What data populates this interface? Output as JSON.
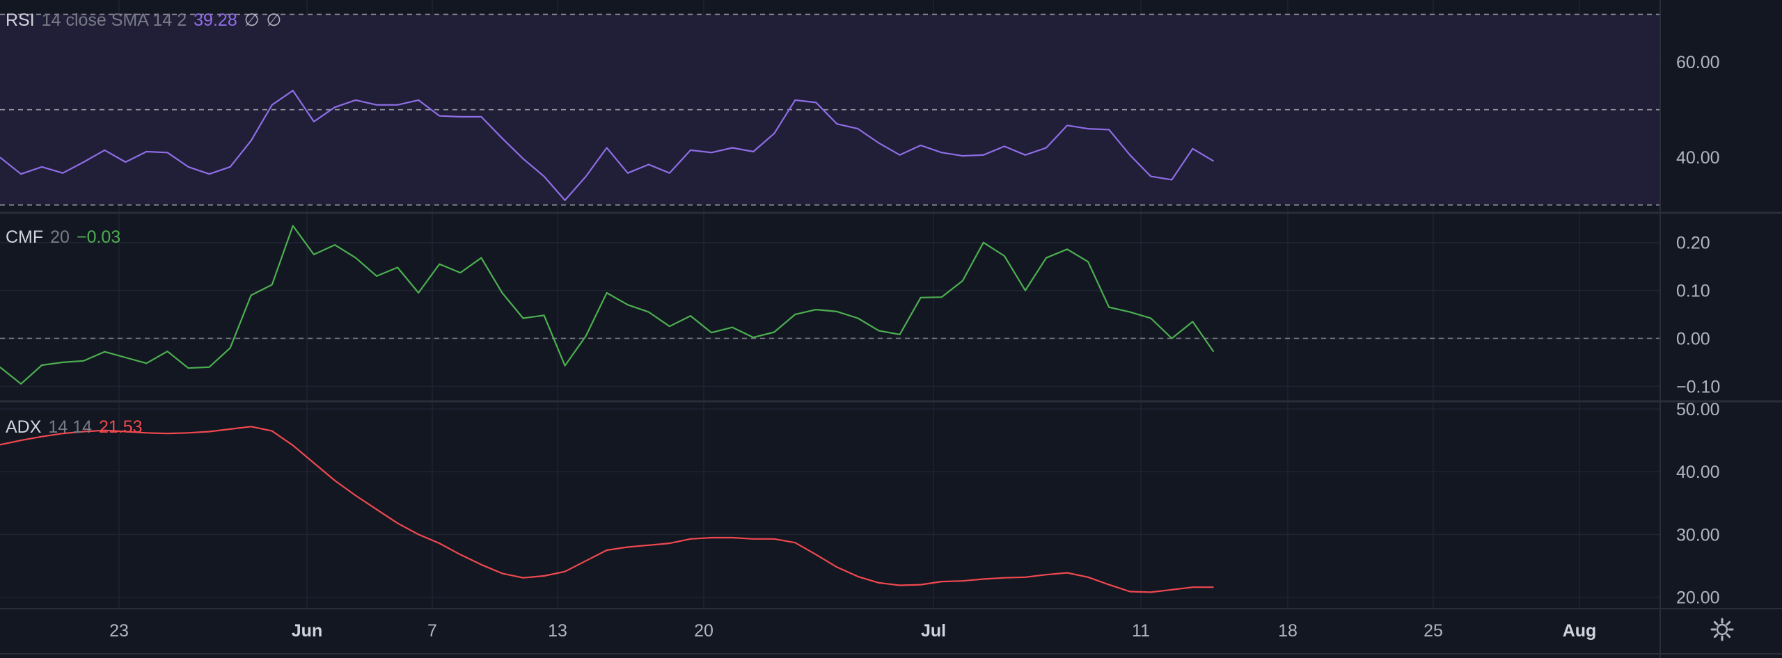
{
  "chart_data": {
    "type": "line",
    "x_axis": {
      "tick_labels": [
        "23",
        "Jun",
        "7",
        "13",
        "20",
        "Jul",
        "11",
        "18",
        "25",
        "Aug"
      ],
      "bold_ticks": [
        "Jun",
        "Jul",
        "Aug"
      ]
    },
    "panes": [
      {
        "id": "rsi",
        "legend": {
          "name": "RSI",
          "params": "14 close SMA 14 2",
          "value": "39.28",
          "extra": [
            "∅",
            "∅"
          ]
        },
        "color": "#8e6ee6",
        "band_fill": "#241f3a",
        "ylim": [
          28.5,
          73
        ],
        "band": [
          30,
          70
        ],
        "middle_line": 50,
        "y_ticks": [
          60,
          40
        ],
        "y_tick_labels": [
          "60.00",
          "40.00"
        ],
        "values": [
          40,
          36.5,
          38,
          36.7,
          39,
          41.5,
          39,
          41.2,
          41,
          38,
          36.5,
          38,
          43.5,
          51,
          54,
          47.5,
          50.5,
          52,
          51,
          51,
          52,
          48.7,
          48.5,
          48.5,
          44,
          39.7,
          36,
          31,
          36,
          42,
          36.7,
          38.5,
          36.7,
          41.5,
          41,
          42,
          41.2,
          45,
          52,
          51.5,
          47,
          46,
          43,
          40.5,
          42.5,
          41,
          40.3,
          40.5,
          42.3,
          40.5,
          42,
          46.7,
          46,
          45.8,
          40.5,
          36,
          35.3,
          41.8,
          39.2
        ]
      },
      {
        "id": "cmf",
        "legend": {
          "name": "CMF",
          "params": "20",
          "value": "−0.03"
        },
        "color": "#4caf50",
        "ylim": [
          -0.13,
          0.262
        ],
        "zero_line": 0,
        "y_ticks": [
          0.2,
          0.1,
          0,
          -0.1
        ],
        "y_tick_labels": [
          "0.20",
          "0.10",
          "0.00",
          "−0.10"
        ],
        "values": [
          -0.06,
          -0.095,
          -0.056,
          -0.05,
          -0.047,
          -0.028,
          -0.04,
          -0.052,
          -0.027,
          -0.062,
          -0.06,
          -0.02,
          0.09,
          0.112,
          0.235,
          0.175,
          0.195,
          0.168,
          0.13,
          0.148,
          0.095,
          0.155,
          0.137,
          0.168,
          0.095,
          0.042,
          0.048,
          -0.057,
          0.005,
          0.095,
          0.07,
          0.055,
          0.025,
          0.047,
          0.012,
          0.023,
          0.002,
          0.013,
          0.05,
          0.06,
          0.056,
          0.042,
          0.016,
          0.008,
          0.085,
          0.086,
          0.12,
          0.2,
          0.172,
          0.1,
          0.168,
          0.186,
          0.16,
          0.065,
          0.055,
          0.042,
          0,
          0.035,
          -0.028
        ]
      },
      {
        "id": "adx",
        "legend": {
          "name": "ADX",
          "params": "14 14",
          "value": "21.53"
        },
        "color": "#f0494f",
        "ylim": [
          18.3,
          51
        ],
        "y_ticks": [
          50,
          40,
          30,
          20
        ],
        "y_tick_labels": [
          "50.00",
          "40.00",
          "30.00",
          "20.00"
        ],
        "values": [
          44.3,
          45,
          45.6,
          46.1,
          46.4,
          46.6,
          46.4,
          46.2,
          46.1,
          46.2,
          46.4,
          46.8,
          47.2,
          46.5,
          44.2,
          41.4,
          38.6,
          36.2,
          34,
          31.8,
          30,
          28.6,
          26.8,
          25.2,
          23.8,
          23.1,
          23.4,
          24.1,
          25.8,
          27.5,
          28,
          28.3,
          28.6,
          29.3,
          29.5,
          29.5,
          29.3,
          29.3,
          28.7,
          26.8,
          24.8,
          23.3,
          22.3,
          21.9,
          22,
          22.5,
          22.6,
          22.9,
          23.1,
          23.2,
          23.6,
          23.9,
          23.2,
          22,
          20.9,
          20.8,
          21.2,
          21.6,
          21.6
        ]
      }
    ]
  }
}
